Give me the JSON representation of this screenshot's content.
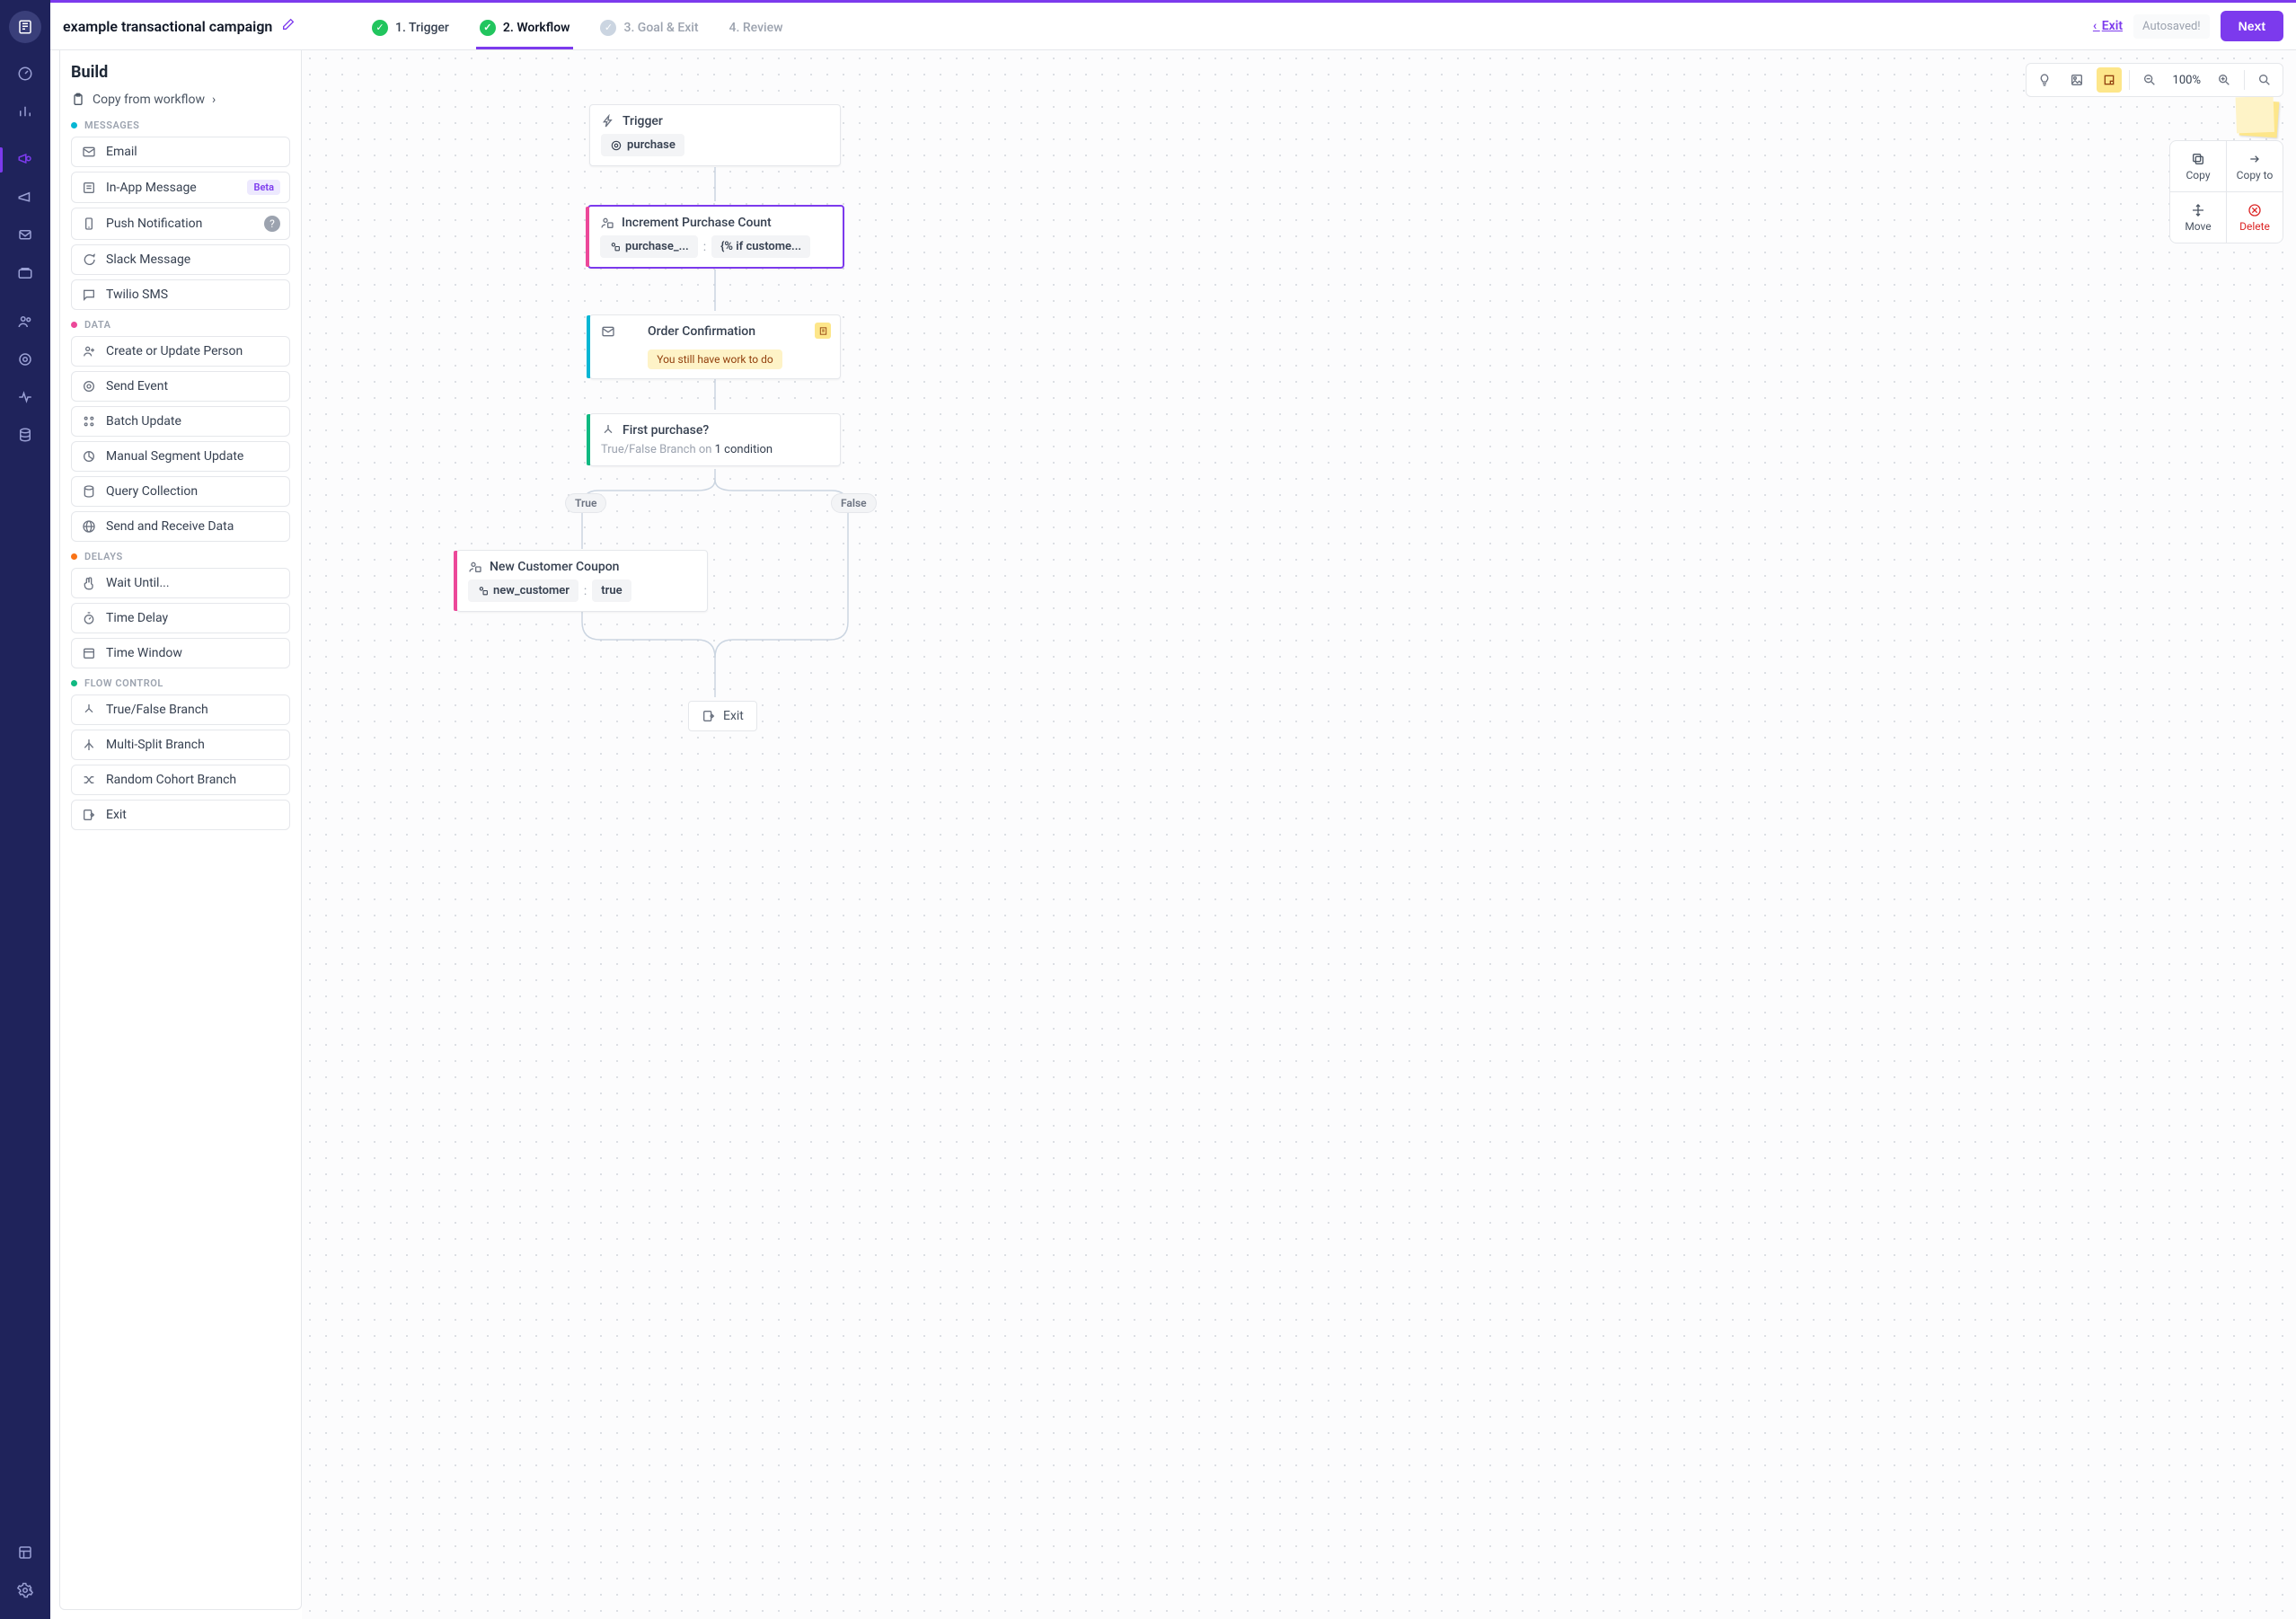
{
  "campaign": {
    "name": "example transactional campaign"
  },
  "steps": [
    {
      "label": "1. Trigger",
      "state": "done"
    },
    {
      "label": "2. Workflow",
      "state": "active"
    },
    {
      "label": "3. Goal & Exit",
      "state": "pending"
    },
    {
      "label": "4. Review",
      "state": "pending-plain"
    }
  ],
  "topbar": {
    "exit": "Exit",
    "autosaved": "Autosaved!",
    "next": "Next"
  },
  "build": {
    "title": "Build",
    "copy_from": "Copy from workflow",
    "categories": {
      "messages": {
        "label": "MESSAGES",
        "items": {
          "email": "Email",
          "inapp": "In-App Message",
          "inapp_badge": "Beta",
          "push": "Push Notification",
          "slack": "Slack Message",
          "twilio": "Twilio SMS"
        }
      },
      "data": {
        "label": "DATA",
        "items": {
          "create_person": "Create or Update Person",
          "send_event": "Send Event",
          "batch": "Batch Update",
          "manual_segment": "Manual Segment Update",
          "query": "Query Collection",
          "webhook": "Send and Receive Data"
        }
      },
      "delays": {
        "label": "DELAYS",
        "items": {
          "wait_until": "Wait Until...",
          "time_delay": "Time Delay",
          "time_window": "Time Window"
        }
      },
      "flow": {
        "label": "FLOW CONTROL",
        "items": {
          "tf_branch": "True/False Branch",
          "multi_split": "Multi-Split Branch",
          "random": "Random Cohort Branch",
          "exit": "Exit"
        }
      }
    }
  },
  "canvas": {
    "zoom": "100%",
    "node_menu": {
      "copy": "Copy",
      "copy_to": "Copy to",
      "move": "Move",
      "delete": "Delete"
    },
    "trigger": {
      "title": "Trigger",
      "event": "purchase"
    },
    "increment": {
      "title": "Increment Purchase Count",
      "attr": "purchase_...",
      "value": "{% if custome..."
    },
    "order_confirm": {
      "title": "Order Confirmation",
      "warn": "You still have work to do"
    },
    "first_purchase": {
      "title": "First purchase?",
      "sub_pre": "True/False Branch on ",
      "sub_num": "1 condition"
    },
    "branch_true": "True",
    "branch_false": "False",
    "coupon": {
      "title": "New Customer Coupon",
      "attr": "new_customer",
      "value": "true"
    },
    "exit": "Exit"
  }
}
